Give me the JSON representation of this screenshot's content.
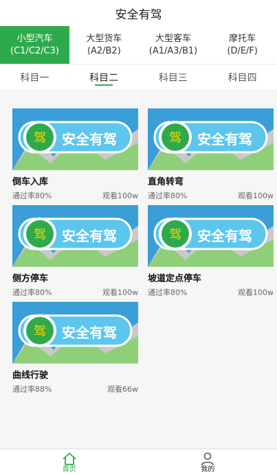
{
  "app": {
    "title": "安全有驾"
  },
  "vehicle_tabs": [
    {
      "line1": "小型汽车",
      "line2": "(C1/C2/C3)"
    },
    {
      "line1": "大型货车",
      "line2": "(A2/B2)"
    },
    {
      "line1": "大型客车",
      "line2": "(A1/A3/B1)"
    },
    {
      "line1": "摩托车",
      "line2": "(D/E/F)"
    }
  ],
  "subject_tabs": [
    "科目一",
    "科目二",
    "科目三",
    "科目四"
  ],
  "thumbnail": {
    "brand_text": "安全有驾",
    "badge_char": "驾"
  },
  "lessons": [
    {
      "title": "倒车入库",
      "pass_rate": "通过率80%",
      "views": "观看100w"
    },
    {
      "title": "直角转弯",
      "pass_rate": "通过率80%",
      "views": "观看100w"
    },
    {
      "title": "侧方停车",
      "pass_rate": "通过率80%",
      "views": "观看100w"
    },
    {
      "title": "坡道定点停车",
      "pass_rate": "通过率80%",
      "views": "观看100w"
    },
    {
      "title": "曲线行驶",
      "pass_rate": "通过率88%",
      "views": "观看66w"
    }
  ],
  "bottom_nav": [
    {
      "label": "首页",
      "icon": "home-icon"
    },
    {
      "label": "我的",
      "icon": "person-icon"
    }
  ],
  "colors": {
    "accent": "#2eaa4c",
    "thumb_sky": "#3b9ed8",
    "logo_fill": "#5cc6ee",
    "logo_text": "#ffffff"
  }
}
